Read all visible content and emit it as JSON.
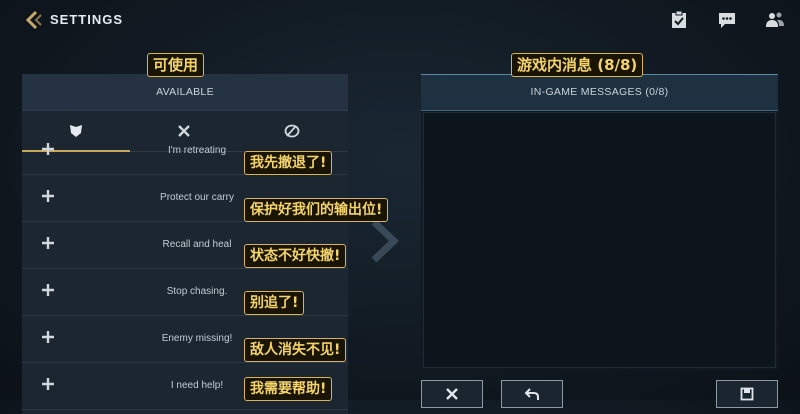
{
  "header": {
    "title": "SETTINGS",
    "icons": [
      "back-chevron-icon",
      "clipboard-check-icon",
      "chat-bubble-icon",
      "people-icon"
    ]
  },
  "available": {
    "title": "AVAILABLE",
    "annotation": "可使用",
    "tabs": [
      {
        "icon": "shield-icon",
        "active": true
      },
      {
        "icon": "crossed-swords-icon",
        "active": false
      },
      {
        "icon": "forbidden-chat-icon",
        "active": false
      }
    ],
    "items": [
      {
        "label": "I'm retreating",
        "annotation": "我先撤退了!"
      },
      {
        "label": "Protect our carry",
        "annotation": "保护好我们的输出位!"
      },
      {
        "label": "Recall and heal",
        "annotation": "状态不好快撤!"
      },
      {
        "label": "Stop chasing.",
        "annotation": "别追了!"
      },
      {
        "label": "Enemy missing!",
        "annotation": "敌人消失不见!"
      },
      {
        "label": "I need help!",
        "annotation": "我需要帮助!"
      }
    ]
  },
  "ingame": {
    "title": "IN-GAME MESSAGES (0/8)",
    "annotation": "游戏内消息 (8/8)"
  },
  "actions": [
    "close-icon",
    "undo-icon",
    "save-icon"
  ],
  "colors": {
    "accent": "#c8a85a",
    "annotation_text": "#f3d36b",
    "annotation_border": "#d7b45a"
  }
}
